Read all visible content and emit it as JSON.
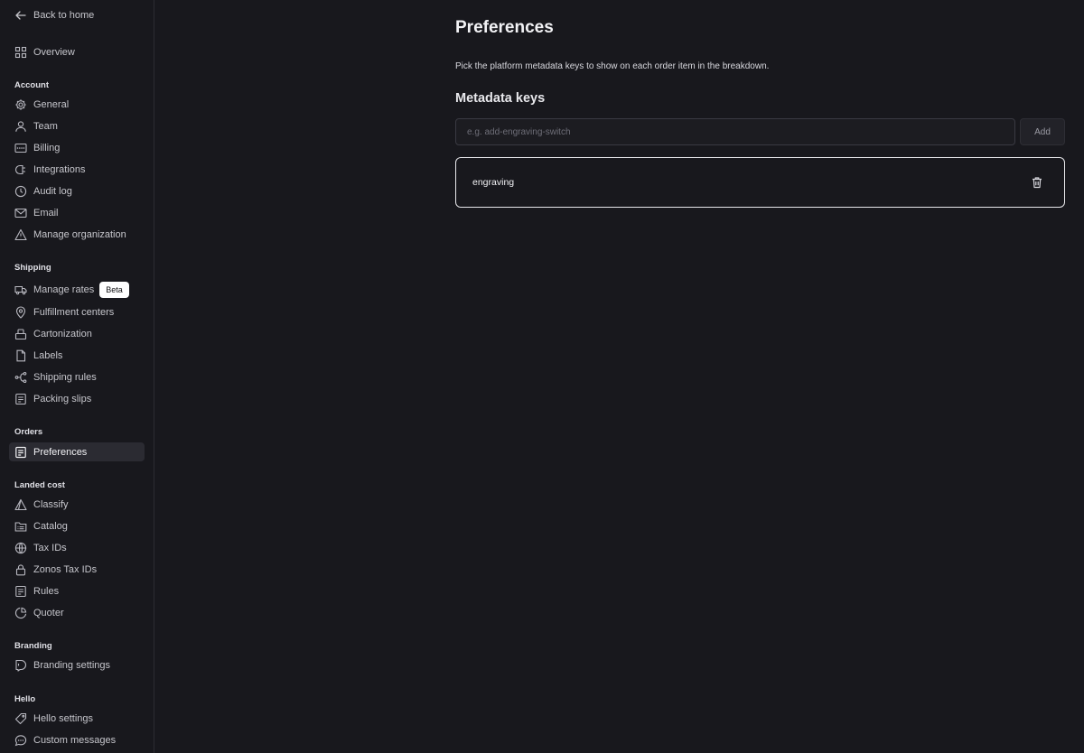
{
  "sidebar": {
    "back_label": "Back to home",
    "overview": "Overview",
    "sections": {
      "account": "Account",
      "shipping": "Shipping",
      "orders": "Orders",
      "landed_cost": "Landed cost",
      "branding": "Branding",
      "hello": "Hello"
    },
    "account_items": [
      "General",
      "Team",
      "Billing",
      "Integrations",
      "Audit log",
      "Email",
      "Manage organization"
    ],
    "shipping_items": [
      "Manage rates",
      "Fulfillment centers",
      "Cartonization",
      "Labels",
      "Shipping rules",
      "Packing slips"
    ],
    "beta_badge": "Beta",
    "orders_items": [
      "Preferences"
    ],
    "landed_cost_items": [
      "Classify",
      "Catalog",
      "Tax IDs",
      "Zonos Tax IDs",
      "Rules",
      "Quoter"
    ],
    "branding_items": [
      "Branding settings"
    ],
    "hello_items": [
      "Hello settings",
      "Custom messages"
    ],
    "active_item": "Preferences"
  },
  "main": {
    "title": "Preferences",
    "description": "Pick the platform metadata keys to show on each order item in the breakdown.",
    "metadata_title": "Metadata keys",
    "input_placeholder": "e.g. add-engraving-switch",
    "input_value": "",
    "add_label": "Add",
    "keys": [
      "engraving"
    ]
  },
  "colors": {
    "background": "#18181d",
    "active_bg": "#2b2b32",
    "text": "#e8e8ec",
    "border": "#2c2c33"
  }
}
